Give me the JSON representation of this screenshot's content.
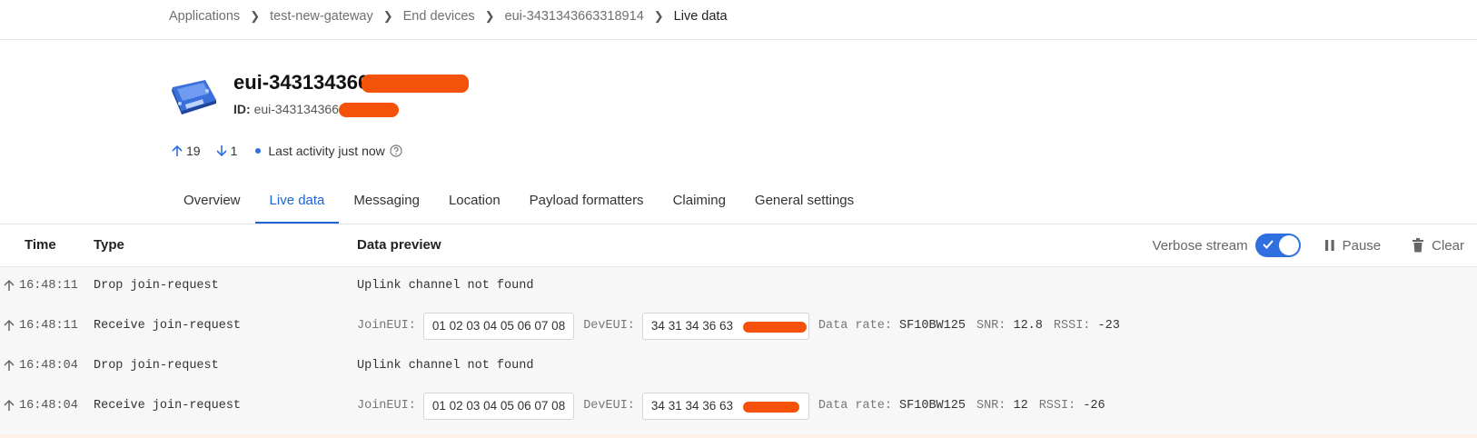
{
  "breadcrumb": [
    {
      "label": "Applications"
    },
    {
      "label": "test-new-gateway"
    },
    {
      "label": "End devices"
    },
    {
      "label": "eui-3431343663318914"
    },
    {
      "label": "Live data"
    }
  ],
  "device": {
    "title": "eui-343134366",
    "id_label": "ID:",
    "id_value": "eui-343134366",
    "icon": "lora-device-icon"
  },
  "stats": {
    "uplink_count": "19",
    "downlink_count": "1",
    "last_activity": "Last activity just now"
  },
  "tabs": [
    {
      "label": "Overview"
    },
    {
      "label": "Live data"
    },
    {
      "label": "Messaging"
    },
    {
      "label": "Location"
    },
    {
      "label": "Payload formatters"
    },
    {
      "label": "Claiming"
    },
    {
      "label": "General settings"
    }
  ],
  "active_tab": "Live data",
  "table": {
    "headers": {
      "time": "Time",
      "type": "Type",
      "preview": "Data preview"
    },
    "verbose_label": "Verbose stream",
    "pause_label": "Pause",
    "clear_label": "Clear",
    "rows": [
      {
        "time": "16:48:11",
        "type": "Drop join-request",
        "preview": "Uplink channel not found"
      },
      {
        "time": "16:48:11",
        "type": "Receive join-request",
        "join_label": "JoinEUI:",
        "join_eui": "01 02 03 04 05 06 07 08",
        "dev_label": "DevEUI:",
        "dev_eui": "34 31 34 36 63",
        "rate_label": "Data rate:",
        "rate": "SF10BW125",
        "snr_label": "SNR:",
        "snr": "12.8",
        "rssi_label": "RSSI:",
        "rssi": "-23"
      },
      {
        "time": "16:48:04",
        "type": "Drop join-request",
        "preview": "Uplink channel not found"
      },
      {
        "time": "16:48:04",
        "type": "Receive join-request",
        "join_label": "JoinEUI:",
        "join_eui": "01 02 03 04 05 06 07 08",
        "dev_label": "DevEUI:",
        "dev_eui": "34 31 34 36 63",
        "rate_label": "Data rate:",
        "rate": "SF10BW125",
        "snr_label": "SNR:",
        "snr": "12",
        "rssi_label": "RSSI:",
        "rssi": "-26"
      }
    ]
  },
  "colors": {
    "accent": "#1f63d8",
    "redaction": "#f4510b"
  }
}
